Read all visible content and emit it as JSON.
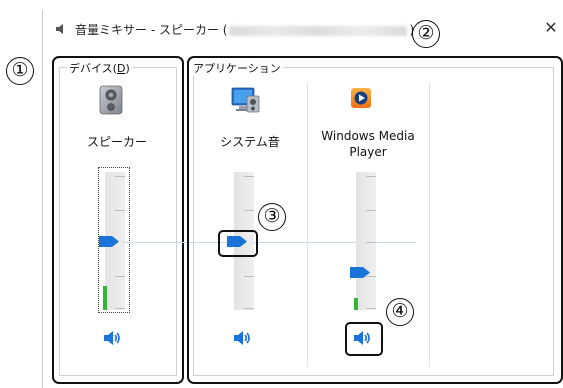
{
  "window": {
    "title_prefix": "音量ミキサー - スピーカー (",
    "title_device_blurred": "Realtek High Definition Audio",
    "title_suffix": ")",
    "close_label": "✕"
  },
  "device_group": {
    "label_prefix": "デバイス(",
    "label_accel": "D",
    "label_suffix": ")",
    "channel": {
      "name": "スピーカー",
      "icon": "speaker-device-icon",
      "level_fraction": 0.47,
      "peak_fraction": 0.16
    }
  },
  "apps_group": {
    "label": "アプリケーション",
    "channels": [
      {
        "name": "システム音",
        "icon": "system-sounds-icon",
        "level_fraction": 0.47
      },
      {
        "name_line1": "Windows Media",
        "name_line2": "Player",
        "icon": "windows-media-player-icon",
        "level_fraction": 0.28,
        "peak_fraction": 0.08
      }
    ]
  },
  "callouts": [
    "①",
    "②",
    "③",
    "④"
  ],
  "colors": {
    "accent": "#1a73d8",
    "peak": "#34b534",
    "track": "#e6e6e6"
  }
}
